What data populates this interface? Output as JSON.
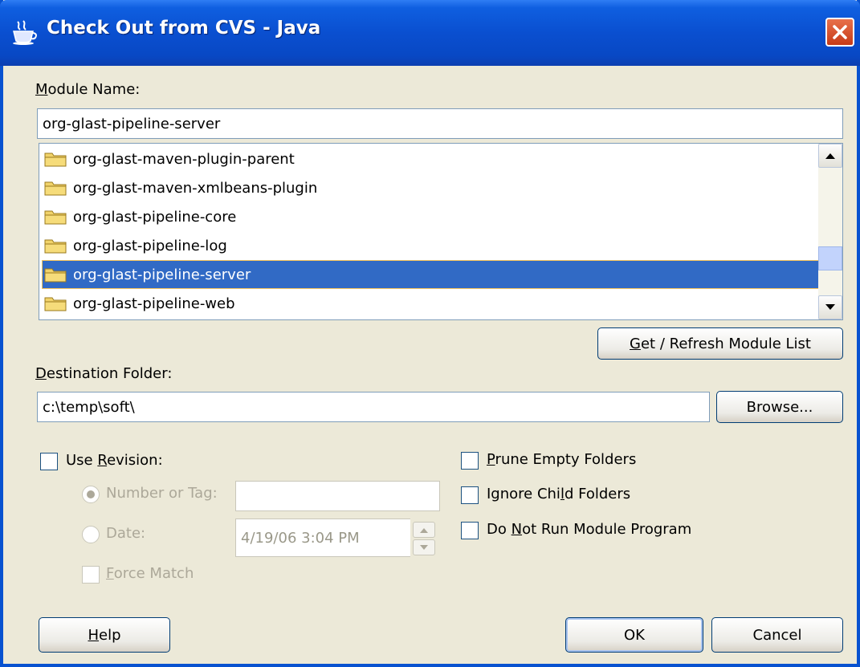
{
  "window": {
    "title": "Check Out from CVS - Java",
    "icon": "java-cup-icon",
    "close_icon": "close-icon"
  },
  "module_name": {
    "label_prefix": "",
    "label_mnemonic": "M",
    "label_rest": "odule Name:",
    "value": "org-glast-pipeline-server"
  },
  "module_list": {
    "items": [
      "org-glast-maven-plugin-parent",
      "org-glast-maven-xmlbeans-plugin",
      "org-glast-pipeline-core",
      "org-glast-pipeline-log",
      "org-glast-pipeline-server",
      "org-glast-pipeline-web"
    ],
    "selected": "org-glast-pipeline-server"
  },
  "refresh_button": {
    "mnemonic": "G",
    "rest": "et / Refresh Module List"
  },
  "destination": {
    "label_mnemonic": "D",
    "label_rest": "estination Folder:",
    "value": "c:\\temp\\soft\\",
    "browse_label": "Browse..."
  },
  "revision": {
    "use_revision_prefix": "Use ",
    "use_revision_mnemonic": "R",
    "use_revision_rest": "evision:",
    "number_or_tag_label": "Number or Tag:",
    "number_or_tag_value": "",
    "date_label": "Date:",
    "date_value": "4/19/06 3:04 PM",
    "force_match_mnemonic": "F",
    "force_match_rest": "orce Match"
  },
  "options": {
    "prune_mnemonic": "P",
    "prune_rest": "rune Empty Folders",
    "ignore_prefix": "Ignore Chi",
    "ignore_mnemonic": "l",
    "ignore_rest": "d Folders",
    "norun_prefix": "Do ",
    "norun_mnemonic": "N",
    "norun_rest": "ot Run Module Program"
  },
  "footer": {
    "help_mnemonic": "H",
    "help_rest": "elp",
    "ok_label": "OK",
    "cancel_label": "Cancel"
  },
  "colors": {
    "titlebar": "#0a4fd0",
    "dialog_bg": "#ece9d8",
    "selection": "#316ac5"
  }
}
